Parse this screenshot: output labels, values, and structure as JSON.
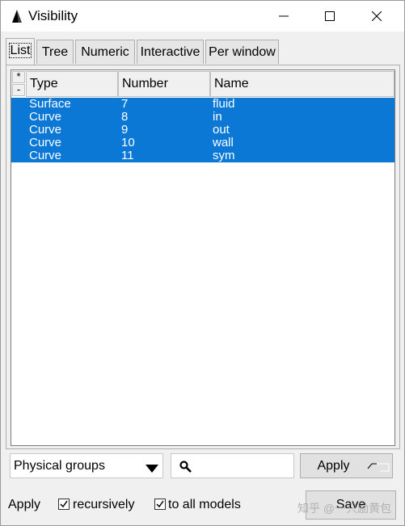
{
  "window": {
    "title": "Visibility"
  },
  "tabs": [
    {
      "label": "List",
      "active": true
    },
    {
      "label": "Tree"
    },
    {
      "label": "Numeric"
    },
    {
      "label": "Interactive"
    },
    {
      "label": "Per window"
    }
  ],
  "browser": {
    "select_all": "*",
    "select_none": "-",
    "columns": [
      "Type",
      "Number",
      "Name"
    ],
    "rows": [
      {
        "type": "Surface",
        "number": "7",
        "name": "fluid"
      },
      {
        "type": "Curve",
        "number": "8",
        "name": "in"
      },
      {
        "type": "Curve",
        "number": "9",
        "name": "out"
      },
      {
        "type": "Curve",
        "number": "10",
        "name": "wall"
      },
      {
        "type": "Curve",
        "number": "11",
        "name": "sym"
      }
    ]
  },
  "controls": {
    "group_select": "Physical groups",
    "search_value": "",
    "apply_button": "Apply"
  },
  "footer": {
    "apply_label": "Apply",
    "recursively": {
      "label": "recursively",
      "checked": true
    },
    "to_all_models": {
      "label": "to all models",
      "checked": true
    },
    "save_button": "Save"
  },
  "watermark": "知乎 @一只励黄包",
  "colors": {
    "selection": "#0c78d5",
    "client": "#f0f0f0"
  }
}
